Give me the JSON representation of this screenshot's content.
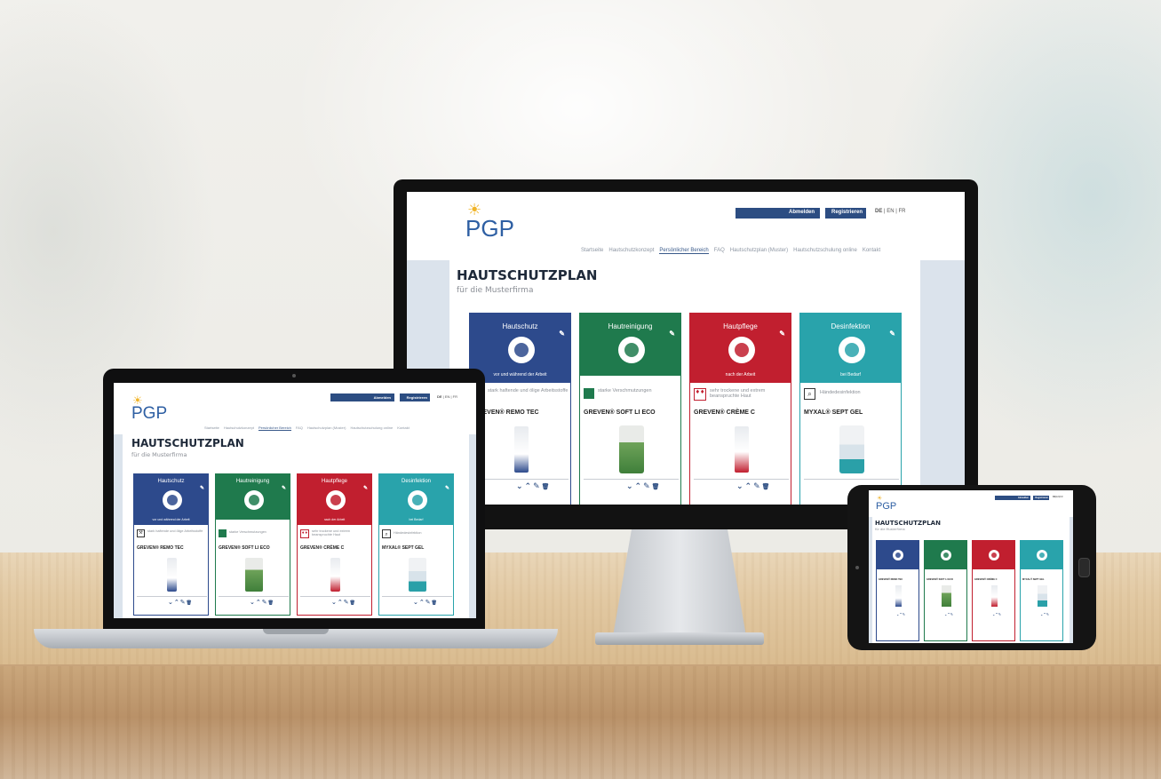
{
  "site": {
    "logo_text": "PGP",
    "login_label": "Abmelden",
    "register_label": "Registrieren",
    "languages": [
      "DE",
      "EN",
      "FR"
    ],
    "nav": [
      {
        "label": "Startseite",
        "active": false
      },
      {
        "label": "Hautschutzkonzept",
        "active": false
      },
      {
        "label": "Persönlicher Bereich",
        "active": true
      },
      {
        "label": "FAQ",
        "active": false
      },
      {
        "label": "Hautschutzplan (Muster)",
        "active": false
      },
      {
        "label": "Hautschutzschulung online",
        "active": false
      },
      {
        "label": "Kontakt",
        "active": false
      }
    ],
    "page_title": "HAUTSCHUTZPLAN",
    "page_subtitle": "für die Musterfirma"
  },
  "cards": [
    {
      "category": "Hautschutz",
      "band": "vor und während der Arbeit",
      "desc": "stark haftende und ölige Arbeitsstoffe",
      "product": "GREVEN® REMO TEC",
      "color": "#2d4a8c",
      "icon": "hand-protection-icon",
      "desc_icon": "oily-substance-icon"
    },
    {
      "category": "Hautreinigung",
      "band": "",
      "desc": "starke Verschmutzungen",
      "product": "GREVEN® SOFT LI ECO",
      "color": "#1f7a4d",
      "icon": "hand-washing-icon",
      "desc_icon": "dirt-icon"
    },
    {
      "category": "Hautpflege",
      "band": "nach der Arbeit",
      "desc": "sehr trockene und extrem beanspruchte Haut",
      "product": "GREVEN® CRÈME C",
      "color": "#c11f2f",
      "icon": "hand-care-icon",
      "desc_icon": "dry-skin-icon"
    },
    {
      "category": "Desinfektion",
      "band": "bei Bedarf",
      "desc": "Händedesinfektion",
      "product": "MYXAL® SEPT GEL",
      "color": "#29a3ab",
      "icon": "hand-disinfection-icon",
      "desc_icon": "magnifier-icon"
    }
  ],
  "laptop_cards": [
    {
      "product": "GREVEN® REMO TEC"
    },
    {
      "product": "GREVEN® SOFT LI ECO"
    },
    {
      "product": "GREVEN® CRÈME C"
    },
    {
      "product": "MYXAL® SEPT GEL"
    }
  ],
  "actions": {
    "down": "⌄",
    "up": "⌃",
    "edit": "✎",
    "delete": "🗑"
  },
  "colors": {
    "bezel": "#111111",
    "silver": "#c8ccd1",
    "brand": "#2c4d82"
  }
}
